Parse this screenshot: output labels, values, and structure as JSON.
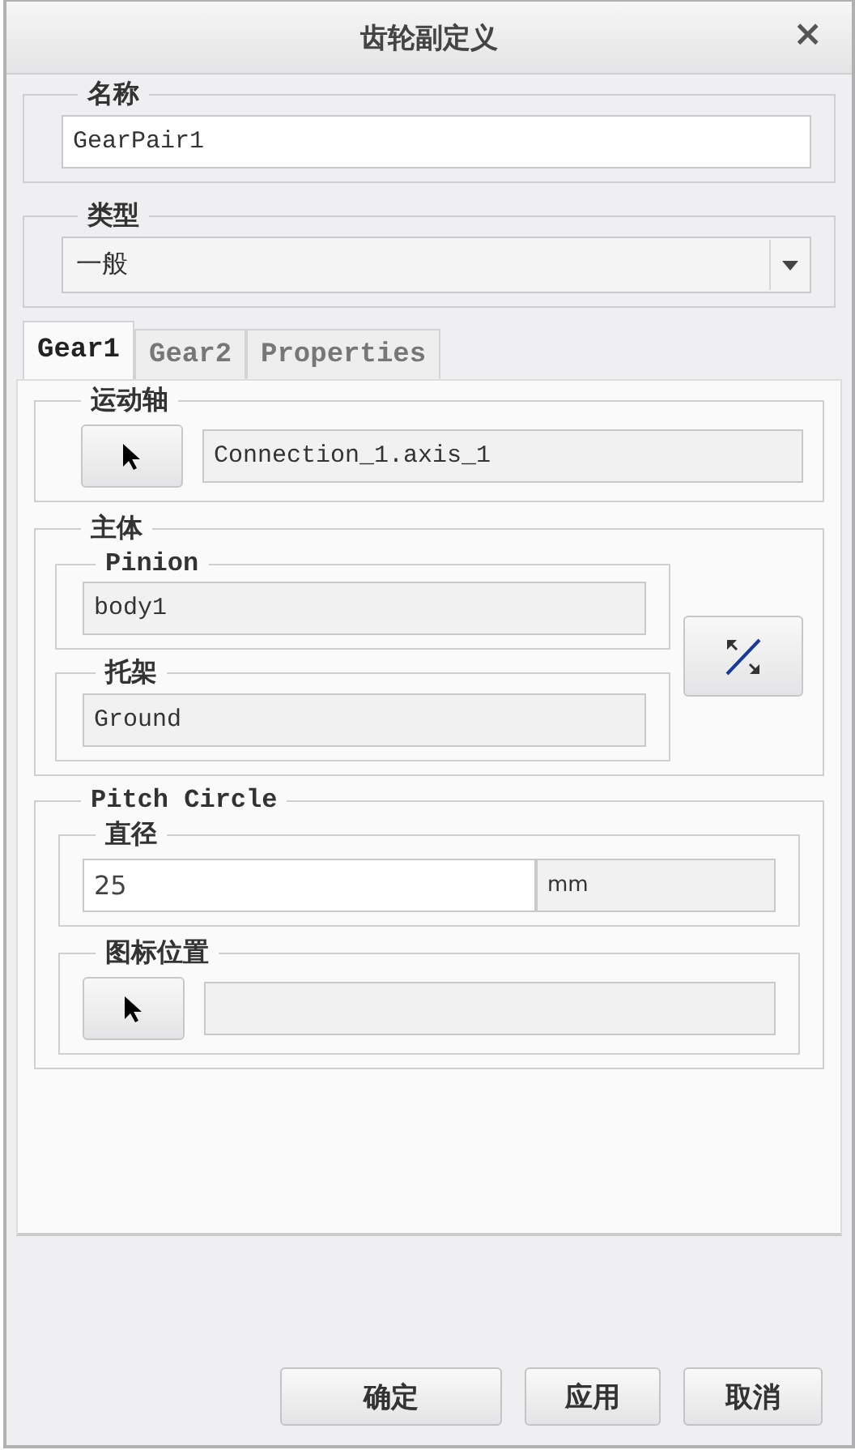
{
  "window": {
    "title": "齿轮副定义",
    "close": "×"
  },
  "name_group": {
    "legend": "名称",
    "value": "GearPair1"
  },
  "type_group": {
    "legend": "类型",
    "value": "一般"
  },
  "tabs": [
    {
      "label": "Gear1",
      "selected": true
    },
    {
      "label": "Gear2",
      "selected": false
    },
    {
      "label": "Properties",
      "selected": false
    }
  ],
  "motion_axis": {
    "legend": "运动轴",
    "value": "Connection_1.axis_1"
  },
  "bodies": {
    "legend": "主体",
    "pinion": {
      "legend": "Pinion",
      "value": "body1"
    },
    "carrier": {
      "legend": "托架",
      "value": "Ground"
    }
  },
  "pitch_circle": {
    "legend": "Pitch Circle",
    "diameter": {
      "legend": "直径",
      "value": "25",
      "unit": "mm"
    },
    "icon_position": {
      "legend": "图标位置"
    }
  },
  "buttons": [
    "确定",
    "应用",
    "取消"
  ]
}
